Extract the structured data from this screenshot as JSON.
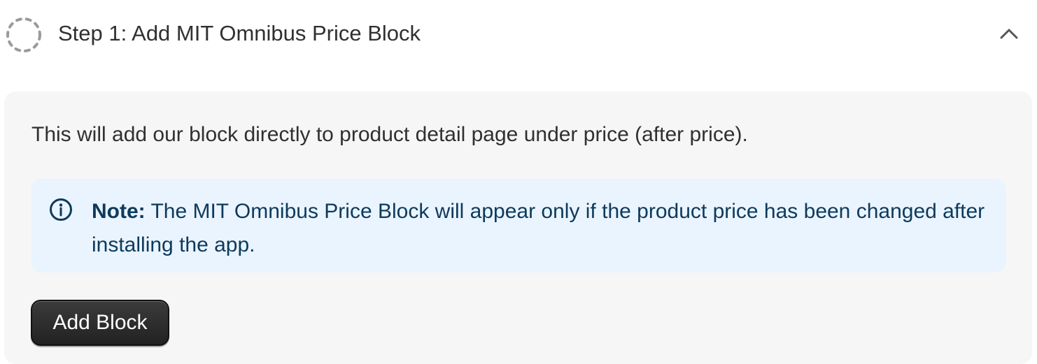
{
  "step": {
    "title": "Step 1: Add MIT Omnibus Price Block",
    "status_icon": "dashed-circle-incomplete-icon",
    "toggle_icon": "chevron-up-icon",
    "description": "This will add our block directly to product detail page under price (after price).",
    "note": {
      "icon": "info-circle-icon",
      "label": "Note:",
      "text": " The MIT Omnibus Price Block will appear only if the product price has been changed after installing the app."
    },
    "button_label": "Add Block"
  },
  "colors": {
    "note_background": "#eaf4fe",
    "note_text": "#0d3a5c",
    "body_background": "#f6f6f6",
    "button_background": "#2b2b2b",
    "title_text": "#303030"
  }
}
